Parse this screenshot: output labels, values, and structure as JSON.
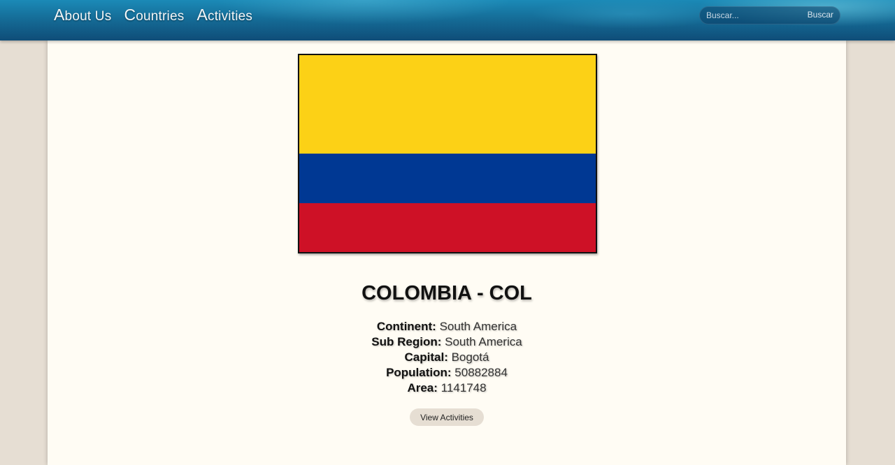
{
  "nav": {
    "items": [
      {
        "first": "A",
        "rest": "bout Us"
      },
      {
        "first": "C",
        "rest": "ountries"
      },
      {
        "first": "A",
        "rest": "ctivities"
      }
    ]
  },
  "search": {
    "placeholder": "Buscar...",
    "value": "",
    "button_label": "Buscar"
  },
  "country": {
    "title": "COLOMBIA - COL",
    "flag_colors": [
      "#fcd116",
      "#003893",
      "#ce1126"
    ],
    "fields": [
      {
        "label": "Continent:",
        "value": "South America"
      },
      {
        "label": "Sub Region:",
        "value": "South America"
      },
      {
        "label": "Capital:",
        "value": "Bogotá"
      },
      {
        "label": "Population:",
        "value": "50882884"
      },
      {
        "label": "Area:",
        "value": "1141748"
      }
    ],
    "view_button_label": "View Activities"
  },
  "colors": {
    "page_background": "#e6ded3",
    "card_background": "#fffcf4",
    "header_blue": "#156d98"
  }
}
